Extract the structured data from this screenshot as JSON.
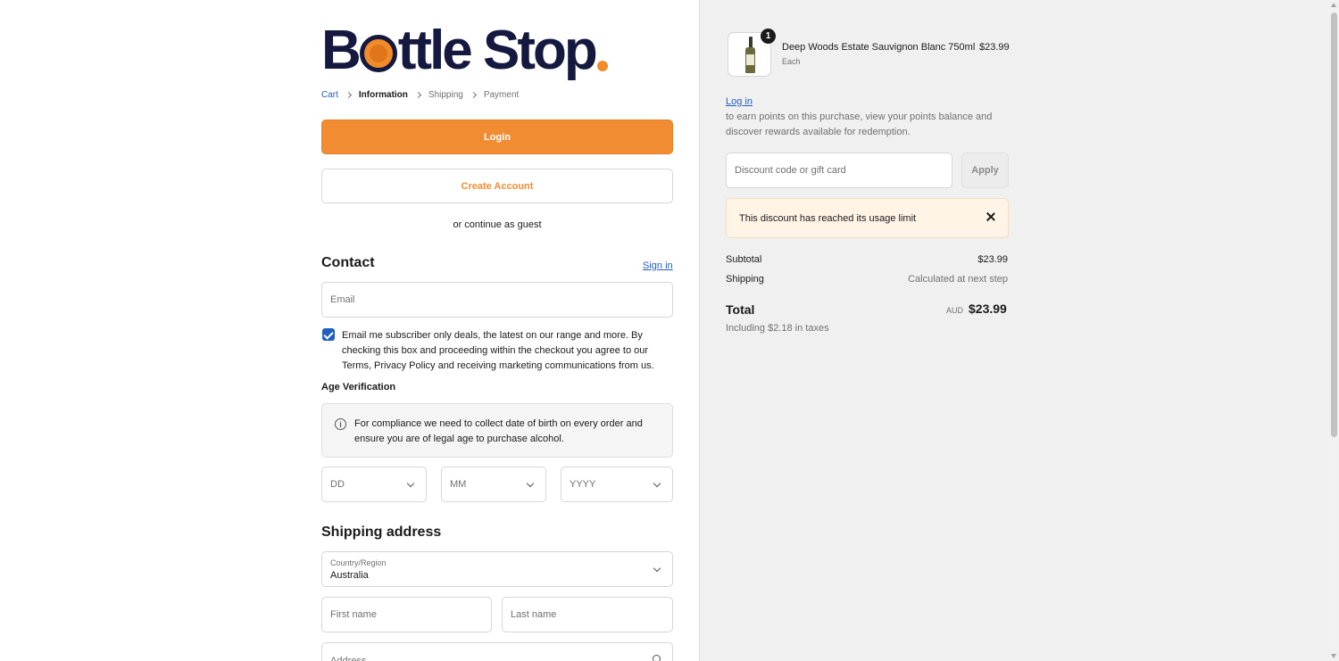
{
  "brand": {
    "logo_part1": "B",
    "logo_part2": "ttle Stop",
    "accent_color": "#f28c33",
    "navy_color": "#15183f"
  },
  "breadcrumb": {
    "cart": "Cart",
    "information": "Information",
    "shipping": "Shipping",
    "payment": "Payment"
  },
  "auth": {
    "login_label": "Login",
    "create_account_label": "Create Account",
    "guest_text": "or continue as guest"
  },
  "contact": {
    "heading": "Contact",
    "sign_in_label": "Sign in",
    "email_placeholder": "Email",
    "marketing_checked": true,
    "marketing_text": "Email me subscriber only deals, the latest on our range and more. By checking this box and proceeding within the checkout you agree to our Terms, Privacy Policy and receiving marketing communications from us."
  },
  "age": {
    "heading": "Age Verification",
    "notice": "For compliance we need to collect date of birth on every order and ensure you are of legal age to purchase alcohol.",
    "day_placeholder": "DD",
    "month_placeholder": "MM",
    "year_placeholder": "YYYY"
  },
  "shipping": {
    "heading": "Shipping address",
    "country_label": "Country/Region",
    "country_value": "Australia",
    "first_name_placeholder": "First name",
    "last_name_placeholder": "Last name",
    "address_placeholder": "Address"
  },
  "order": {
    "item": {
      "name": "Deep Woods Estate Sauvignon Blanc 750ml",
      "unit": "Each",
      "price": "$23.99",
      "quantity": "1"
    },
    "login_link": "Log in",
    "points_text": "to earn points on this purchase, view your points balance and discover rewards available for redemption.",
    "discount_placeholder": "Discount code or gift card",
    "apply_label": "Apply",
    "alert_text": "This discount has reached its usage limit",
    "subtotal_label": "Subtotal",
    "subtotal_value": "$23.99",
    "shipping_label": "Shipping",
    "shipping_value": "Calculated at next step",
    "total_label": "Total",
    "currency": "AUD",
    "total_value": "$23.99",
    "taxes_text": "Including $2.18 in taxes"
  }
}
